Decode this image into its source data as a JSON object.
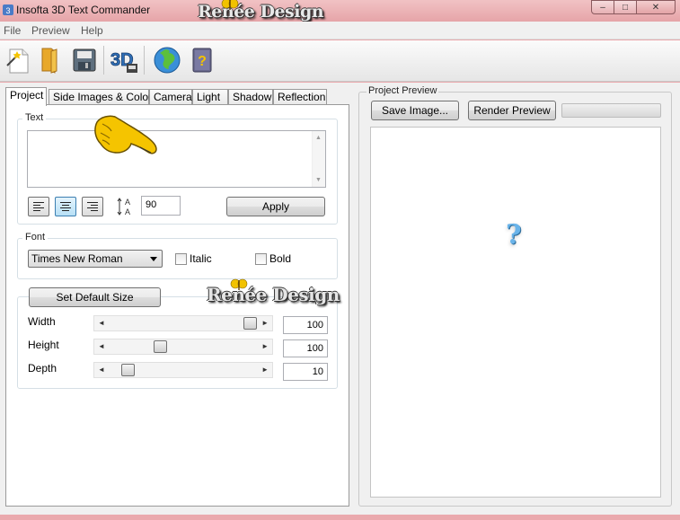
{
  "window": {
    "title": "Insofta 3D Text Commander",
    "controls": {
      "minimize": "–",
      "maximize": "□",
      "close": "✕"
    }
  },
  "watermark": {
    "text": "Renée Design"
  },
  "menu": {
    "items": [
      "File",
      "Preview",
      "Help"
    ]
  },
  "toolbar": {
    "buttons": [
      "new-wizard-icon",
      "open-folder-icon",
      "save-icon",
      "3d-text-icon",
      "web-globe-icon",
      "help-book-icon"
    ],
    "labels": {
      "3d": "3D",
      "help": "?"
    }
  },
  "tabs": [
    "Project",
    "Side Images & Colors",
    "Camera",
    "Light",
    "Shadow",
    "Reflection"
  ],
  "project": {
    "text_group": {
      "title": "Text",
      "value": "",
      "size_value": "90",
      "apply_label": "Apply",
      "size_icon_label": "A"
    },
    "font_group": {
      "title": "Font",
      "font_name": "Times New Roman",
      "italic_label": "Italic",
      "italic_checked": false,
      "bold_label": "Bold",
      "bold_checked": false
    },
    "size_group": {
      "default_button": "Set Default Size",
      "width_label": "Width",
      "width_value": "100",
      "height_label": "Height",
      "height_value": "100",
      "depth_label": "Depth",
      "depth_value": "10"
    }
  },
  "preview": {
    "title": "Project Preview",
    "save_label": "Save Image...",
    "render_label": "Render Preview",
    "placeholder": "?"
  },
  "colors": {
    "titlebar": "#e6a4a8",
    "accent_blue": "#3c7fb1",
    "placeholder_blue": "#6ab4ea",
    "hand_yellow": "#f5c400"
  }
}
